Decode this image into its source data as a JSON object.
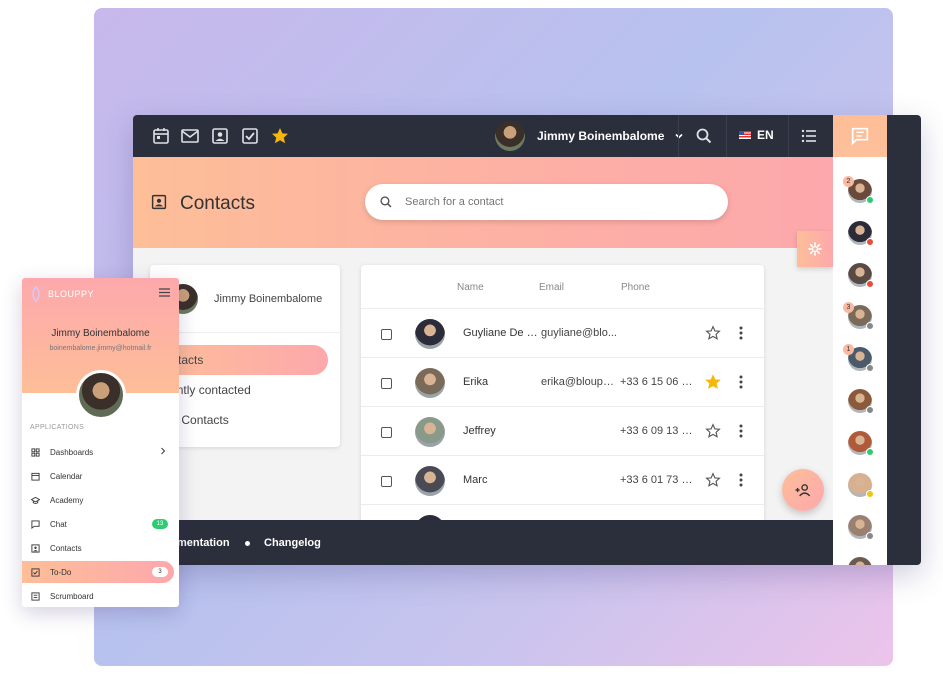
{
  "topbar": {
    "icons": [
      "calendar-icon",
      "mail-icon",
      "contacts-icon",
      "todo-icon",
      "star-icon"
    ],
    "user_name": "Jimmy Boinembalome",
    "language": "EN"
  },
  "header": {
    "title": "Contacts",
    "search_placeholder": "Search for a contact"
  },
  "left_card": {
    "user_name": "Jimmy Boinembalome",
    "items": [
      {
        "label": "l Contacts",
        "active": true
      },
      {
        "label": "equently contacted",
        "active": false
      },
      {
        "label": "arred Contacts",
        "active": false
      }
    ]
  },
  "table": {
    "headers": {
      "name": "Name",
      "email": "Email",
      "phone": "Phone"
    },
    "rows": [
      {
        "name": "Guyliane De J...",
        "email": "guyliane@blo...",
        "phone": "",
        "starred": false,
        "avatar_color": "#2b2b3a"
      },
      {
        "name": "Erika",
        "email": "erika@bloupp...",
        "phone": "+33 6 15 06 8...",
        "starred": true,
        "avatar_color": "#7a6a5a"
      },
      {
        "name": "Jeffrey",
        "email": "",
        "phone": "+33 6 09 13 0...",
        "starred": false,
        "avatar_color": "#8a9a8a"
      },
      {
        "name": "Marc",
        "email": "",
        "phone": "+33 6 01 73 8...",
        "starred": false,
        "avatar_color": "#4a4a55"
      }
    ]
  },
  "footer": {
    "documentation": "mentation",
    "changelog": "Changelog"
  },
  "chat_contacts": [
    {
      "badge": "2",
      "status": "#2ecc71",
      "color": "#6a4a3a"
    },
    {
      "badge": "",
      "status": "#e74c3c",
      "color": "#2b2b3a"
    },
    {
      "badge": "",
      "status": "#e74c3c",
      "color": "#5a4a44"
    },
    {
      "badge": "3",
      "status": "#888888",
      "color": "#7a6a5a"
    },
    {
      "badge": "1",
      "status": "#888888",
      "color": "#4a5a6a"
    },
    {
      "badge": "",
      "status": "#888888",
      "color": "#8a5a3a"
    },
    {
      "badge": "",
      "status": "#2ecc71",
      "color": "#b05a3a"
    },
    {
      "badge": "",
      "status": "#f1c40f",
      "color": "#d8b090"
    },
    {
      "badge": "",
      "status": "#888888",
      "color": "#9a8070"
    },
    {
      "badge": "",
      "status": "#888888",
      "color": "#6a5a50"
    }
  ],
  "mobile": {
    "logo": "BLOUPPY",
    "user_name": "Jimmy Boinembalome",
    "email": "boinembalome.jimmy@hotmail.fr",
    "section": "APPLICATIONS",
    "items": [
      {
        "label": "Dashboards",
        "icon": "dashboard-icon",
        "chevron": true,
        "badge": "",
        "active": false
      },
      {
        "label": "Calendar",
        "icon": "calendar-icon",
        "chevron": false,
        "badge": "",
        "active": false
      },
      {
        "label": "Academy",
        "icon": "academy-icon",
        "chevron": false,
        "badge": "",
        "active": false
      },
      {
        "label": "Chat",
        "icon": "chat-icon",
        "chevron": false,
        "badge": "13",
        "active": false
      },
      {
        "label": "Contacts",
        "icon": "contacts-icon",
        "chevron": false,
        "badge": "",
        "active": false
      },
      {
        "label": "To-Do",
        "icon": "todo-icon",
        "chevron": false,
        "badge": "3",
        "active": true
      },
      {
        "label": "Scrumboard",
        "icon": "scrumboard-icon",
        "chevron": false,
        "badge": "",
        "active": false
      }
    ]
  },
  "colors": {
    "accent_start": "#fdbe98",
    "accent_end": "#fda8ac",
    "dark": "#2b2e3b",
    "star": "#f6b60b",
    "badge_green": "#2ecc71"
  }
}
